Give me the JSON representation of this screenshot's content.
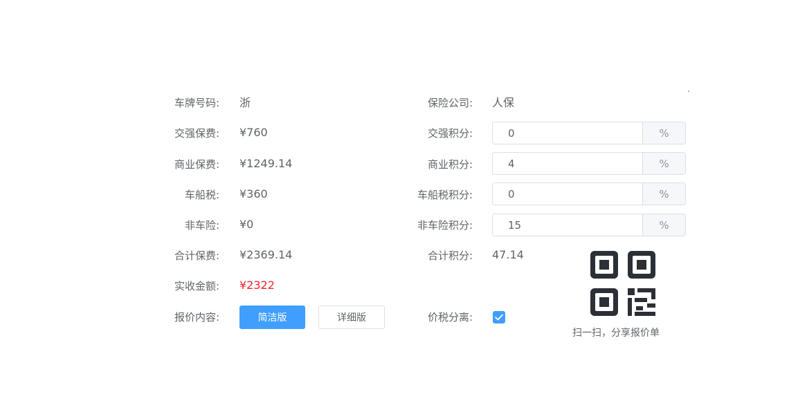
{
  "left": {
    "rows": [
      {
        "label": "车牌号码:",
        "value": "浙"
      },
      {
        "label": "交强保费:",
        "value": "¥760"
      },
      {
        "label": "商业保费:",
        "value": "¥1249.14"
      },
      {
        "label": "车船税:",
        "value": "¥360"
      },
      {
        "label": "非车险:",
        "value": "¥0"
      },
      {
        "label": "合计保费:",
        "value": "¥2369.14"
      },
      {
        "label": "实收金额:",
        "value": "¥2322"
      },
      {
        "label": "报价内容:"
      }
    ]
  },
  "right": {
    "insurer_label": "保险公司:",
    "insurer_value": "人保",
    "points": [
      {
        "label": "交强积分:",
        "value": "0",
        "suffix": "%"
      },
      {
        "label": "商业积分:",
        "value": "4",
        "suffix": "%"
      },
      {
        "label": "车船税积分:",
        "value": "0",
        "suffix": "%"
      },
      {
        "label": "非车险积分:",
        "value": "15",
        "suffix": "%"
      }
    ],
    "total_points_label": "合计积分:",
    "total_points_value": "47.14",
    "tax_separation_label": "价税分离:",
    "tax_separation_checked": true
  },
  "buttons": {
    "simple": "简洁版",
    "detailed": "详细版"
  },
  "qr": {
    "caption": "扫一扫，分享报价单"
  },
  "colors": {
    "accent": "#409eff",
    "amount_red": "#f5222d"
  }
}
